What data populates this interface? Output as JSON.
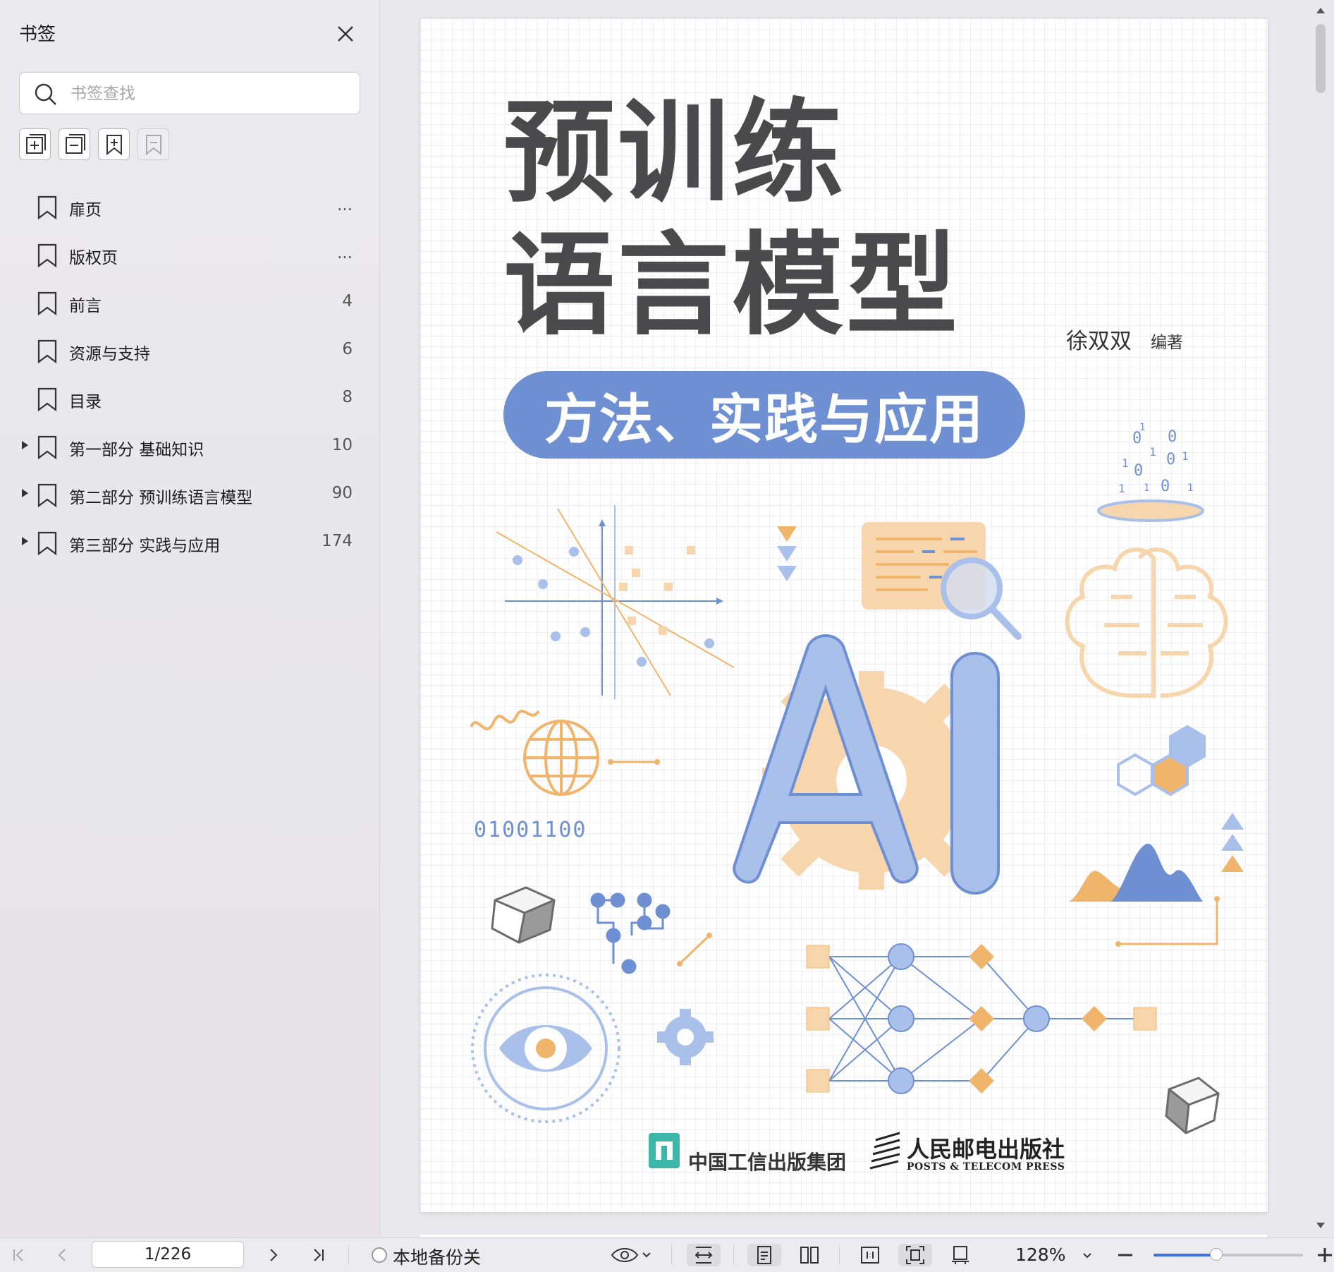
{
  "sidebar": {
    "title": "书签",
    "search_placeholder": "书签查找",
    "items": [
      {
        "label": "扉页",
        "page": "...",
        "expandable": false
      },
      {
        "label": "版权页",
        "page": "...",
        "expandable": false
      },
      {
        "label": "前言",
        "page": "4",
        "expandable": false
      },
      {
        "label": "资源与支持",
        "page": "6",
        "expandable": false
      },
      {
        "label": "目录",
        "page": "8",
        "expandable": false
      },
      {
        "label": "第一部分 基础知识",
        "page": "10",
        "expandable": true
      },
      {
        "label": "第二部分 预训练语言模型",
        "page": "90",
        "expandable": true
      },
      {
        "label": "第三部分 实践与应用",
        "page": "174",
        "expandable": true
      }
    ]
  },
  "cover": {
    "title_line1": "预训练",
    "title_line2": "语言模型",
    "author": "徐双双",
    "author_role": "编著",
    "subtitle": "方法、实践与应用",
    "binary_text": "01001100",
    "ai_text": "AI",
    "publisher1": "中国工信出版集团",
    "publisher2": "人民邮电出版社",
    "publisher2_en": "POSTS & TELECOM PRESS",
    "colors": {
      "blue": "#6f8fd3",
      "light_blue": "#a9c0ea",
      "orange": "#f0b46a",
      "peach": "#f8d6ad",
      "dark_text": "#4a4a4c"
    }
  },
  "toolbar": {
    "page_value": "1/226",
    "backup_label": "本地备份关",
    "zoom_label": "128%",
    "zoom_fraction": 0.42
  }
}
